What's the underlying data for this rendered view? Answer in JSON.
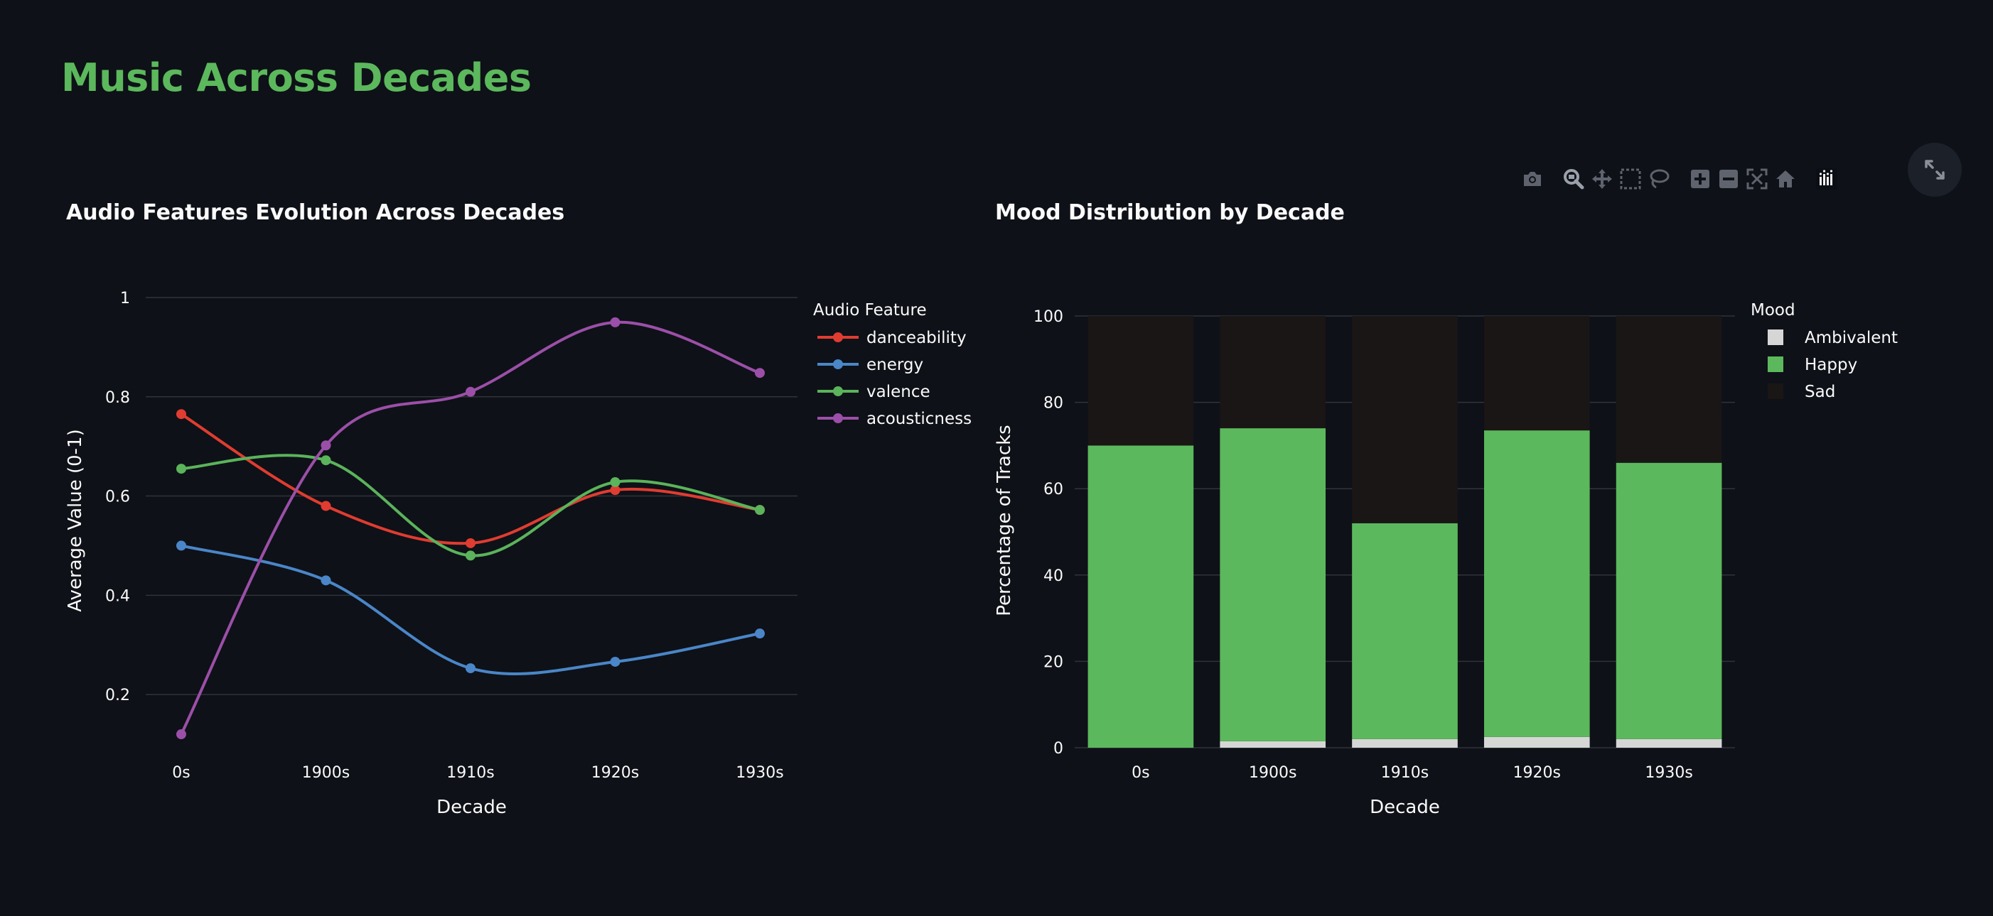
{
  "page": {
    "title": "Music Across Decades"
  },
  "colors": {
    "title": "#5cb85c",
    "background": "#0e1117"
  },
  "modebar": {
    "icons": [
      "camera-icon",
      "zoom-icon",
      "pan-icon",
      "box-select-icon",
      "lasso-icon",
      "zoom-in-icon",
      "zoom-out-icon",
      "autoscale-icon",
      "reset-axes-icon",
      "plotly-logo-icon"
    ]
  },
  "chart_data": [
    {
      "type": "line",
      "title": "Audio Features Evolution Across Decades",
      "xlabel": "Decade",
      "ylabel": "Average Value (0-1)",
      "categories": [
        "0s",
        "1900s",
        "1910s",
        "1920s",
        "1930s"
      ],
      "y_ticks": [
        "0.2",
        "0.4",
        "0.6",
        "0.8",
        "1"
      ],
      "ylim": [
        0.1,
        1.02
      ],
      "grid": true,
      "legend_title": "Audio Feature",
      "legend_position": "right",
      "series": [
        {
          "name": "danceability",
          "color": "#e03c31",
          "values": [
            0.765,
            0.58,
            0.505,
            0.612,
            0.572
          ]
        },
        {
          "name": "energy",
          "color": "#4a86c8",
          "values": [
            0.5,
            0.43,
            0.253,
            0.266,
            0.323
          ]
        },
        {
          "name": "valence",
          "color": "#5bb35b",
          "values": [
            0.655,
            0.672,
            0.48,
            0.628,
            0.572
          ]
        },
        {
          "name": "acousticness",
          "color": "#9b4fa8",
          "values": [
            0.12,
            0.702,
            0.81,
            0.95,
            0.848
          ]
        }
      ]
    },
    {
      "type": "bar",
      "stacked": true,
      "title": "Mood Distribution by Decade",
      "xlabel": "Decade",
      "ylabel": "Percentage of Tracks",
      "categories": [
        "0s",
        "1900s",
        "1910s",
        "1920s",
        "1930s"
      ],
      "y_ticks": [
        "0",
        "20",
        "40",
        "60",
        "80",
        "100"
      ],
      "ylim": [
        0,
        100
      ],
      "grid": true,
      "legend_title": "Mood",
      "legend_position": "right",
      "series": [
        {
          "name": "Ambivalent",
          "color": "#d6d6d6",
          "values": [
            0,
            1.5,
            2,
            2.5,
            2
          ]
        },
        {
          "name": "Happy",
          "color": "#5cb85c",
          "values": [
            70,
            72.5,
            50,
            71,
            64
          ]
        },
        {
          "name": "Sad",
          "color": "#1a1616",
          "values": [
            30,
            26,
            48,
            26.5,
            34
          ]
        }
      ]
    }
  ]
}
